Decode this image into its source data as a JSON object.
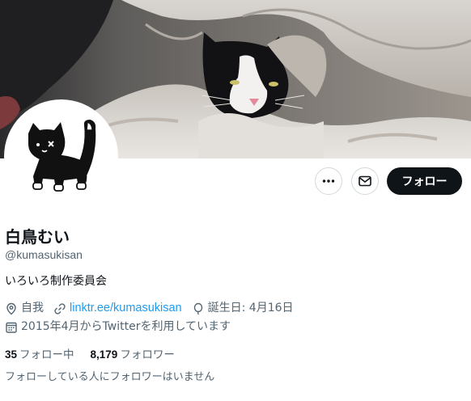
{
  "profile": {
    "display_name": "白鳥むい",
    "handle": "@kumasukisan",
    "bio": "いろいろ制作委員会",
    "location": "自我",
    "link": "linktr.ee/kumasukisan",
    "birthday": "誕生日: 4月16日",
    "joined": "2015年4月からTwitterを利用しています"
  },
  "actions": {
    "more_icon": "more-icon",
    "message_icon": "mail-icon",
    "follow_label": "フォロー"
  },
  "stats": {
    "following_count": "35",
    "following_label": "フォロー中",
    "followers_count": "8,179",
    "followers_label": "フォロワー"
  },
  "followers_you_know": "フォローしている人にフォロワーはいません",
  "colors": {
    "text": "#0f1419",
    "secondary_text": "#536471",
    "link": "#1d9bf0",
    "follow_button": "#0f1419",
    "border": "#cfd9de"
  }
}
